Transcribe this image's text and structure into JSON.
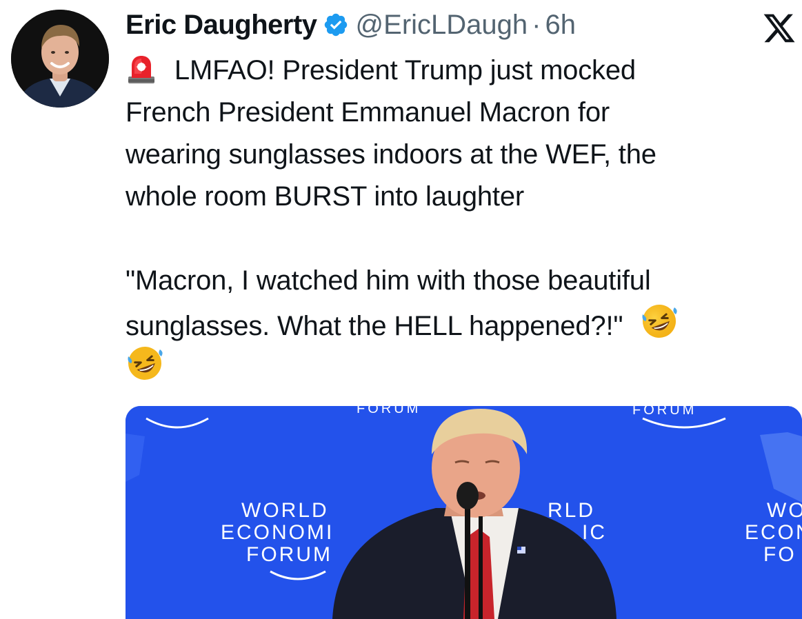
{
  "author": {
    "display_name": "Eric Daugherty",
    "handle": "@EricLDaugh",
    "separator": "·",
    "time": "6h",
    "verified": true,
    "avatar_icon": "profile-photo"
  },
  "platform": {
    "logo_icon": "x-logo"
  },
  "tweet": {
    "siren_icon": "rotating-light-emoji",
    "lines": [
      "LMFAO! President Trump just mocked",
      "French President Emmanuel Macron for",
      "wearing sunglasses indoors at the WEF, the",
      "whole room BURST into laughter"
    ],
    "quote_lines": [
      "\"Macron, I watched him with those beautiful",
      "sunglasses. What the HELL happened?!\""
    ],
    "laugh_emoji_icon": "rolling-on-floor-laughing-emoji"
  },
  "media": {
    "logo_texts": [
      {
        "l1": "WORLD",
        "l2": "ECONOMI",
        "l3": "FORUM"
      },
      {
        "l1": "RLD",
        "l2": "IC"
      },
      {
        "l1": "WO",
        "l2": "ECON",
        "l3": "FO"
      }
    ],
    "top_texts": [
      "FORUM",
      "FORUM"
    ],
    "colors": {
      "background": "#1f4ee8",
      "suit": "#1a1d2b",
      "tie": "#c8242b",
      "skin": "#e9a589"
    }
  },
  "colors": {
    "text_primary": "#0f1419",
    "text_secondary": "#536471",
    "verified_blue": "#1d9bf0"
  }
}
